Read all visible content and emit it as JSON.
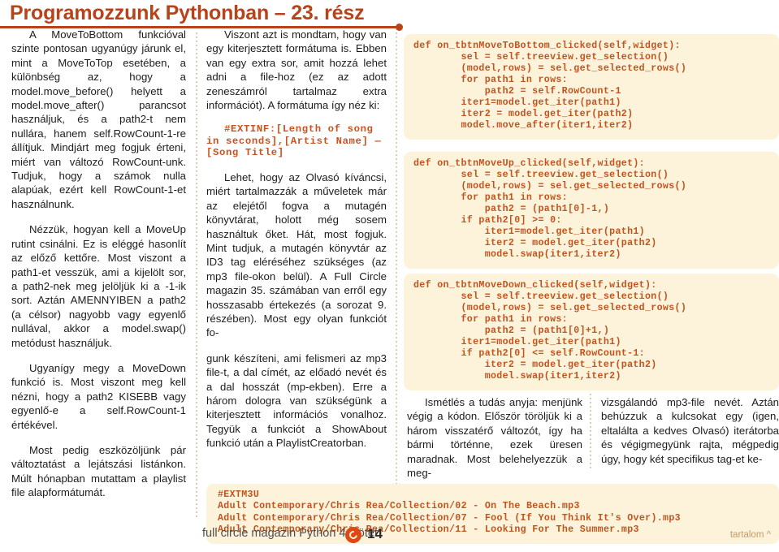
{
  "title": "Programozzunk Pythonban – 23. rész",
  "colors": {
    "accent": "#b8431a",
    "code_text": "#c0541f",
    "code_bg": "#fdf3db",
    "logo": "#dd4814",
    "toc_link": "#c49a6c"
  },
  "columns": {
    "left": [
      "A MoveToBottom funkcióval szinte pontosan ugyanúgy járunk el, mint a MoveToTop esetében, a különbség az, hogy a model.move_before() helyett a model.move_after() parancsot használjuk, és a path2-t nem nullára, hanem self.RowCount-1-re állítjuk. Mindjárt meg fogjuk érteni, miért van változó RowCount-unk. Tudjuk, hogy a számok nulla alapúak, ezért kell RowCount-1-et használnunk.",
      "Nézzük, hogyan kell a MoveUp rutint csinálni. Ez is eléggé hasonlít az előző kettőre. Most viszont a path1-et vesszük, ami a kijelölt sor, a path2-nek meg jelöljük ki a -1-ik sort. Aztán AMENNYIBEN a path2 (a célsor) nagyobb vagy egyenlő nullával, akkor a model.swap() metódust használjuk.",
      "Ugyanígy megy a MoveDown funkció is. Most viszont meg kell nézni, hogy a path2 KISEBB vagy egyenlő-e a self.RowCount-1 értékével.",
      "Most pedig eszközöljünk pár változtatást a lejátszási listánkon. Múlt hónapban mutattam a playlist file alapformátumát."
    ],
    "middle": {
      "para1": "Viszont azt is mondtam, hogy van egy kiterjesztett formátuma is. Ebben van egy extra sor, amit hozzá lehet adni a file-hoz (ez az adott zeneszámról tartalmaz extra információt). A formátuma így néz ki:",
      "snippet": "#EXTINF:[Length of song in seconds],[Artist Name] —\n[Song Title]",
      "para2": "Lehet, hogy az Olvasó kíváncsi, miért tartalmazzák a műveletek már az elejétől fogva a mutagén könyvtárat, holott még sosem használtuk őket. Hát, most fogjuk. Mint tudjuk, a mutagén könyvtár az ID3 tag eléréséhez szükséges (az mp3 file-okon belül). A Full Circle magazin 35. számában van erről egy hosszasabb értekezés (a sorozat 9. részében). Most egy olyan funkciót fo-",
      "para3": "gunk készíteni, ami felismeri az mp3 file-t, a dal címét, az előadó nevét és a dal hosszát (mp-ekben). Erre a három dologra van szükségünk a kiterjesztett információs vonalhoz.  Tegyük a funkciót a ShowAbout funkció után a PlaylistCreatorban."
    },
    "bottom_right_left": "Ismétlés a tudás anyja: menjünk végig a kódon. Először töröljük ki a három visszatérő változót, így ha bármi történne, ezek üresen maradnak. Most belehelyezzük a meg-",
    "bottom_right_right": "vizsgálandó mp3-file nevét. Aztán behúzzuk a kulcsokat egy (igen, eltalálta a kedves Olvasó) iterátorba és végigmegyünk rajta, mégpedig úgy, hogy két specifikus tag-et ke-"
  },
  "code_blocks": {
    "move_to_bottom": "def on_tbtnMoveToBottom_clicked(self,widget):\n        sel = self.treeview.get_selection()\n        (model,rows) = sel.get_selected_rows()\n        for path1 in rows:\n            path2 = self.RowCount-1\n        iter1=model.get_iter(path1)\n        iter2 = model.get_iter(path2)\n        model.move_after(iter1,iter2)",
    "move_up": "def on_tbtnMoveUp_clicked(self,widget):\n        sel = self.treeview.get_selection()\n        (model,rows) = sel.get_selected_rows()\n        for path1 in rows:\n            path2 = (path1[0]-1,)\n        if path2[0] >= 0:\n            iter1=model.get_iter(path1)\n            iter2 = model.get_iter(path2)\n            model.swap(iter1,iter2)",
    "move_down": "def on_tbtnMoveDown_clicked(self,widget):\n        sel = self.treeview.get_selection()\n        (model,rows) = sel.get_selected_rows()\n        for path1 in rows:\n            path2 = (path1[0]+1,)\n        iter1=model.get_iter(path1)\n        if path2[0] <= self.RowCount-1:\n            iter2 = model.get_iter(path2)\n            model.swap(iter1,iter2)",
    "playlist": "#EXTM3U\nAdult Contemporary/Chris Rea/Collection/02 - On The Beach.mp3\nAdult Contemporary/Chris Rea/Collection/07 - Fool (If You Think It's Over).mp3\nAdult Contemporary/Chris Rea/Collection/11 - Looking For The Summer.mp3"
  },
  "footer": {
    "text": "full circle magazin Python 4. kötet",
    "page_number": "14",
    "toc_link": "tartalom ^"
  }
}
